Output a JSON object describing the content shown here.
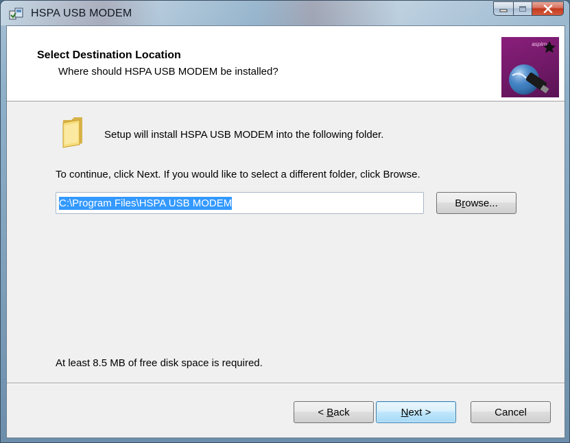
{
  "window": {
    "title": "HSPA USB MODEM"
  },
  "header": {
    "title": "Select Destination Location",
    "subtitle": "Where should HSPA USB MODEM be installed?",
    "brand": "aspiro"
  },
  "body": {
    "intro": "Setup will install HSPA USB MODEM into the following folder.",
    "continue_hint": "To continue, click Next. If you would like to select a different folder, click Browse.",
    "path_value": "C:\\Program Files\\HSPA USB MODEM",
    "browse_pre": "B",
    "browse_accel": "r",
    "browse_post": "owse...",
    "disk_space": "At least 8.5 MB of free disk space is required."
  },
  "footer": {
    "back_pre": "< ",
    "back_accel": "B",
    "back_post": "ack",
    "next_accel": "N",
    "next_post": "ext >",
    "cancel_label": "Cancel"
  },
  "colors": {
    "selection": "#3399ff",
    "header_image": "#7a1a6e"
  },
  "icons": [
    "setup-app-icon",
    "minimize-icon",
    "maximize-icon",
    "close-icon",
    "folder-icon",
    "globe-usb-icon"
  ]
}
